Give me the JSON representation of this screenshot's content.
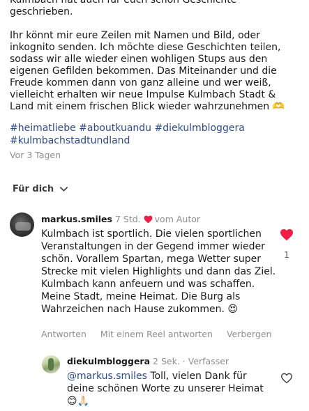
{
  "post": {
    "caption_lead": "Kulmbach hat auch für euch schon Geschichte geschrieben.",
    "caption_body": "Ihr könnt mir eure Zeilen mit Namen und Bild, oder inkognito senden. Ich möchte diese Geschichten teilen, sodass wir alle wieder einen wohligen Stups aus den eigenen Gefilden bekommen. Das Miteinander und die Freude kommen dann von ganz alleine und wer weiß, vielleicht erhalten wir neue Impulse Kulmbach Stadt & Land mit einem frischen Blick wieder wahrzunehmen 🫶",
    "hashtags": [
      "#heimatliebe",
      "#aboutkuandu",
      "#diekulmbloggera",
      "#kulmbachstadtundland"
    ],
    "timestamp": "Vor 3 Tagen"
  },
  "sort": {
    "label": "Für dich",
    "icon": "chevron-down-icon"
  },
  "comment": {
    "username": "markus.smiles",
    "time": "7 Std.",
    "author_badge": "vom Autor",
    "text": "Kulmbach ist sportlich. Die vielen sportlichen Veranstaltungen in der Gegend immer wieder schön. Vorallem Spartan, mega Wetter super Strecke mit vielen Highlights und dann das Ziel. Kulmbach kann anfeuern und was schaffen. Meine Stadt, meine Heimat. Die Burg als Wahrzeichen nach Hause zukommen. 😍",
    "like_count": "1",
    "actions": {
      "reply": "Antworten",
      "reel_reply": "Mit einem Reel antworten",
      "hide": "Verbergen"
    },
    "colors": {
      "heart": "#ed1e47"
    }
  },
  "reply": {
    "username": "diekulmbloggera",
    "time": "2 Sek.",
    "role": "Verfasser",
    "mention": "@markus.smiles",
    "text": " Toll, vielen Dank für deine schönen Worte zu unserer Heimat 😊🙏🏻"
  },
  "colors": {
    "link": "#2c4a8a",
    "muted": "#8e8e8e"
  }
}
